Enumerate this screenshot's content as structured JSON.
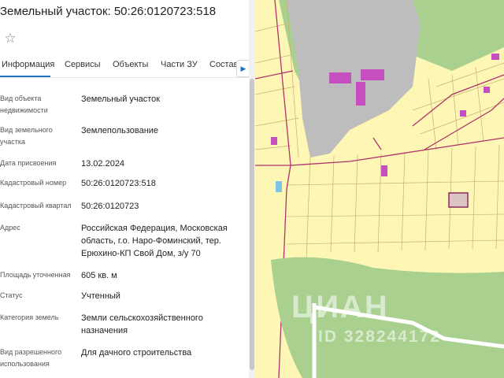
{
  "panel": {
    "title": "Земельный участок: 50:26:0120723:518",
    "star_icon": "star-outline-icon",
    "tabs": [
      {
        "label": "Информация"
      },
      {
        "label": "Сервисы"
      },
      {
        "label": "Объекты"
      },
      {
        "label": "Части ЗУ"
      },
      {
        "label": "Состав"
      }
    ],
    "tab_arrow_icon": "chevron-right-icon",
    "rows": [
      {
        "label": "Вид объекта недвижимости",
        "value": "Земельный участок"
      },
      {
        "label": "Вид земельного участка",
        "value": "Землепользование"
      },
      {
        "label": "Дата присвоения",
        "value": "13.02.2024"
      },
      {
        "label": "Кадастровый номер",
        "value": "50:26:0120723:518"
      },
      {
        "label": "Кадастровый квартал",
        "value": "50:26:0120723"
      },
      {
        "label": "Адрес",
        "value": "Российская Федерация, Московская область, г.о. Наро-Фоминский, тер. Ерюхино-КП Свой Дом, з/у 70"
      },
      {
        "label": "Площадь уточненная",
        "value": "605 кв. м"
      },
      {
        "label": "Статус",
        "value": "Учтенный"
      },
      {
        "label": "Категория земель",
        "value": "Земли сельскохозяйственного назначения"
      },
      {
        "label": "Вид разрешенного использования",
        "value": "Для дачного строительства"
      }
    ]
  },
  "map": {
    "watermark": "ЦИАН",
    "watermark_id": "ID 328244172",
    "colors": {
      "parcel_fill": "#fdf6b5",
      "parcel_line": "#c9b070",
      "boundary": "#b0336d",
      "building": "#c64fc0",
      "forest": "#a9d08e",
      "industrial": "#bdbdbd",
      "selected_parcel": "#dcc4c4",
      "selected_border": "#8b2a63"
    }
  }
}
